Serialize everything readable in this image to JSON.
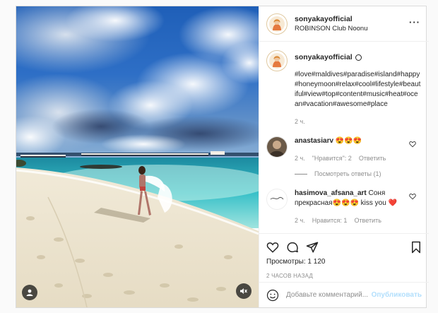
{
  "post": {
    "username": "sonyakayofficial",
    "location": "ROBINSON Club Noonu",
    "more_icon": "more-dots-icon"
  },
  "caption": {
    "username": "sonyakayofficial",
    "text": "#love#maldives#paradise#island#happy#honeymoon#relax#cool#lifestyle#beautiful#view#top#content#music#heat#ocean#vacation#awesome#place",
    "time": "2 ч."
  },
  "comments": [
    {
      "username": "anastasiarv",
      "text": "😍😍😍",
      "time": "2 ч.",
      "likes": "\"Нравится\": 2",
      "reply": "Ответить",
      "view_replies": "Посмотреть ответы (1)"
    },
    {
      "username": "hasimova_afsana_art",
      "text": "Соня прекрасная😍😍😍 kiss you ❤️",
      "time": "2 ч.",
      "likes": "Нравится: 1",
      "reply": "Ответить"
    }
  ],
  "actions": {
    "views_label": "Просмотры:",
    "views_count": "1 120",
    "ago": "2 ЧАСОВ НАЗАД"
  },
  "add_comment": {
    "placeholder": "Добавьте комментарий...",
    "publish": "Опубликовать"
  },
  "colors": {
    "link_disabled": "#b2dffc",
    "heart_red": "#ed4956",
    "muted_text": "#8e8e8e"
  }
}
